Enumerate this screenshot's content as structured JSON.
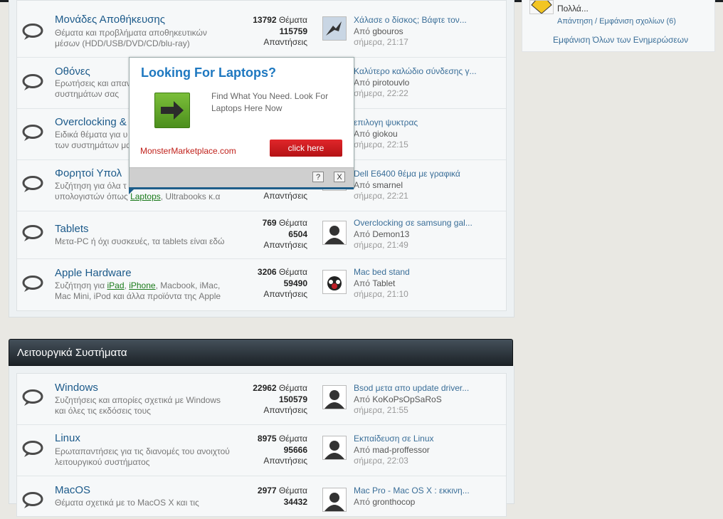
{
  "right_panel": {
    "preview_text": "Πολλά...",
    "reply_link": "Απάντηση / Εμφάνιση σχολίων (6)",
    "show_all": "Εμφάνιση Όλων των Ενημερώσεων"
  },
  "section1": {
    "forums": [
      {
        "name": "Μονάδες Αποθήκευσης",
        "desc1": "Θέματα και προβλήματα αποθηκευτικών",
        "desc2": "μέσων (HDD/USB/DVD/CD/blu-ray)",
        "threads": "13792",
        "threads_label": "Θέματα",
        "posts": "115759",
        "posts_label": "Απαντήσεις",
        "last_title": "Χάλασε ο δίσκος; Βάφτε τον...",
        "last_by": "Από",
        "last_user": "gbouros",
        "last_time": "σήμερα, 21:17"
      },
      {
        "name": "Οθόνες",
        "desc1": "Ερωτήσεις και απαν",
        "desc2": "συστημάτων σας",
        "last_title": "Καλύτερο καλώδιο σύνδεσης γ...",
        "last_by": "Από",
        "last_user": "pirotouvlo",
        "last_time": "σήμερα, 22:22"
      },
      {
        "name": "Overclocking &",
        "desc1": "Ειδικά θέματα για υ",
        "desc2": "των συστημάτων μα",
        "last_title": "επιλογη ψυκτρας",
        "last_by": "Από",
        "last_user": "giokou",
        "last_time": "σήμερα, 22:15"
      },
      {
        "name": "Φορητοί Υπολ",
        "desc1": "Συζήτηση για όλα τ",
        "desc2_pre": "υπολογιστών όπως ",
        "desc2_link": "Laptops",
        "desc2_post": ", Ultrabooks κ.α",
        "posts_label": "Απαντήσεις",
        "last_title": "Dell E6400 θέμα με γραφικά",
        "last_by": "Από",
        "last_user": "smarnel",
        "last_time": "σήμερα, 22:21"
      },
      {
        "name": "Tablets",
        "desc1": "Μετα-PC ή όχι συσκευές, τα tablets είναι εδώ",
        "threads": "769",
        "threads_label": "Θέματα",
        "posts": "6504",
        "posts_label": "Απαντήσεις",
        "last_title": "Overclocking σε samsung gal...",
        "last_by": "Από",
        "last_user": "Demon13",
        "last_time": "σήμερα, 21:49"
      },
      {
        "name": "Apple Hardware",
        "desc1_pre": "Συζήτηση για ",
        "desc1_link1": "iPad",
        "desc1_sep": ", ",
        "desc1_link2": "iPhone",
        "desc1_post": ", Macbook, iMac,",
        "desc2": "Mac Mini, iPod και άλλα προϊόντα της Apple",
        "threads": "3206",
        "threads_label": "Θέματα",
        "posts": "59490",
        "posts_label": "Απαντήσεις",
        "last_title": "Mac bed stand",
        "last_by": "Από",
        "last_user": "Tablet",
        "last_time": "σήμερα, 21:10"
      }
    ]
  },
  "section2": {
    "title": "Λειτουργικά Συστήματα",
    "forums": [
      {
        "name": "Windows",
        "desc1": "Συζητήσεις και απορίες σχετικά με Windows",
        "desc2": "και όλες τις εκδόσεις τους",
        "threads": "22962",
        "threads_label": "Θέματα",
        "posts": "150579",
        "posts_label": "Απαντήσεις",
        "last_title": "Bsod μετα απο update driver...",
        "last_by": "Από",
        "last_user": "KoKoPsOpSaRoS",
        "last_time": "σήμερα, 21:55"
      },
      {
        "name": "Linux",
        "desc1": "Ερωταπαντήσεις για τις διανομές του ανοιχτού",
        "desc2": "λειτουργικού συστήματος",
        "threads": "8975",
        "threads_label": "Θέματα",
        "posts": "95666",
        "posts_label": "Απαντήσεις",
        "last_title": "Εκπαίδευση σε Linux",
        "last_by": "Από",
        "last_user": "mad-proffessor",
        "last_time": "σήμερα, 22:03"
      },
      {
        "name": "MacOS",
        "desc1": "Θέματα σχετικά με το MacOS X και τις",
        "threads": "2977",
        "threads_label": "Θέματα",
        "posts": "34432",
        "last_title": "Mac Pro - Mac OS X : εκκινη...",
        "last_by": "Από",
        "last_user": "gronthocop"
      }
    ]
  },
  "ad": {
    "title": "Looking For Laptops?",
    "text": "Find What You Need. Look For Laptops Here Now",
    "site": "MonsterMarketplace.com",
    "button": "click here",
    "help": "?",
    "close": "X",
    "colors": {
      "title": "#1e78c0",
      "button": "#c8191d",
      "site": "#c0201a"
    }
  }
}
